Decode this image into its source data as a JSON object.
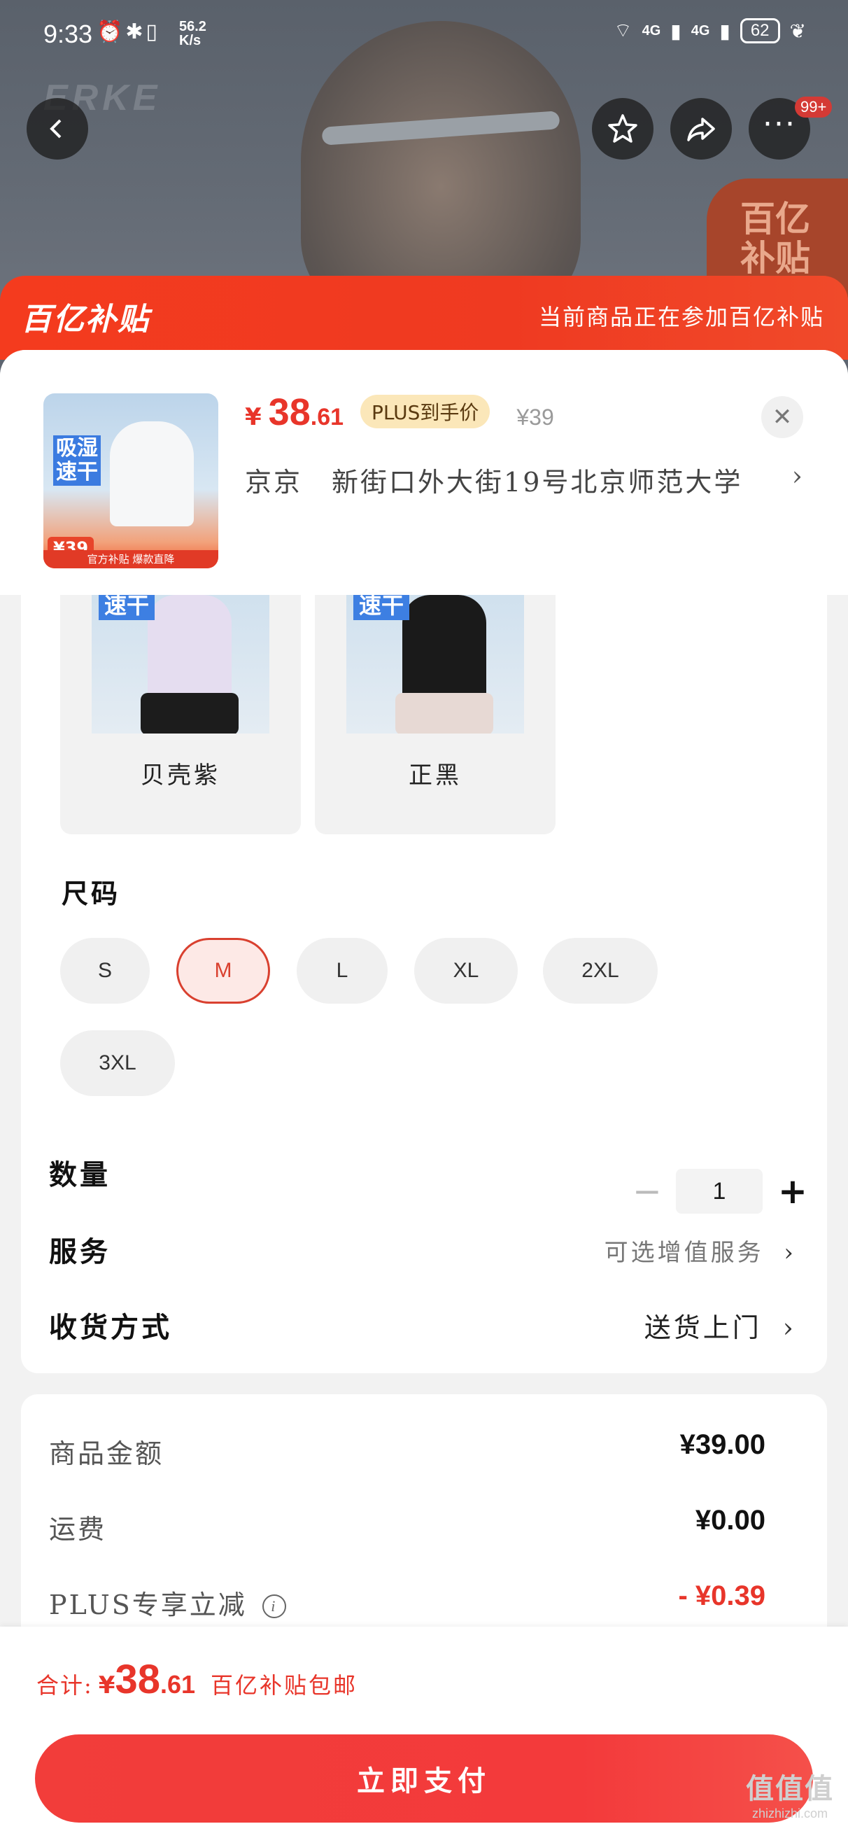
{
  "status_bar": {
    "time": "9:33",
    "net_speed": "56.2",
    "net_speed_unit": "K/s",
    "net_4g_1": "4G",
    "net_4g_2": "4G",
    "battery": "62"
  },
  "background": {
    "brand_logo": "ERKE",
    "badge_line1": "百亿",
    "badge_line2": "补贴"
  },
  "top_actions": {
    "cart_badge": "99+"
  },
  "banner": {
    "logo": "百亿补贴",
    "tip": "当前商品正在参加百亿补贴"
  },
  "product": {
    "thumb_text1": "吸湿",
    "thumb_text2": "速干",
    "thumb_price": "39",
    "thumb_strip": "官方补贴 爆款直降",
    "price_symbol": "¥",
    "price_int": "38",
    "price_dec": ".61",
    "plus_tag": "PLUS到手价",
    "original_price": "¥39"
  },
  "address": {
    "city": "京京",
    "detail": "新街口外大街19号北京师范大学"
  },
  "colors": {
    "options": [
      {
        "label": "贝壳紫",
        "thumb_text": "速干"
      },
      {
        "label": "正黑",
        "thumb_text": "速干"
      }
    ]
  },
  "size": {
    "title": "尺码",
    "options": [
      "S",
      "M",
      "L",
      "XL",
      "2XL",
      "3XL"
    ],
    "selected": "M"
  },
  "quantity": {
    "label": "数量",
    "value": "1",
    "minus": "−",
    "plus": "+"
  },
  "service": {
    "label": "服务",
    "value": "可选增值服务"
  },
  "delivery": {
    "label": "收货方式",
    "value": "送货上门"
  },
  "fees": {
    "goods_label": "商品金额",
    "goods_value": "¥39.00",
    "shipping_label": "运费",
    "shipping_value": "¥0.00",
    "plus_label": "PLUS专享立减",
    "plus_value": "- ¥0.39"
  },
  "footer": {
    "total_label": "合计:",
    "total_symbol": "¥",
    "total_int": "38",
    "total_dec": ".61",
    "total_note": "百亿补贴包邮",
    "pay_label": "立即支付",
    "watermark": "值值值",
    "watermark_sub": "zhizhizhi.com"
  },
  "colors_theme": {
    "accent": "#e8352a",
    "banner": "#f43b1e",
    "plus_tag_bg": "#fbe7b9"
  }
}
